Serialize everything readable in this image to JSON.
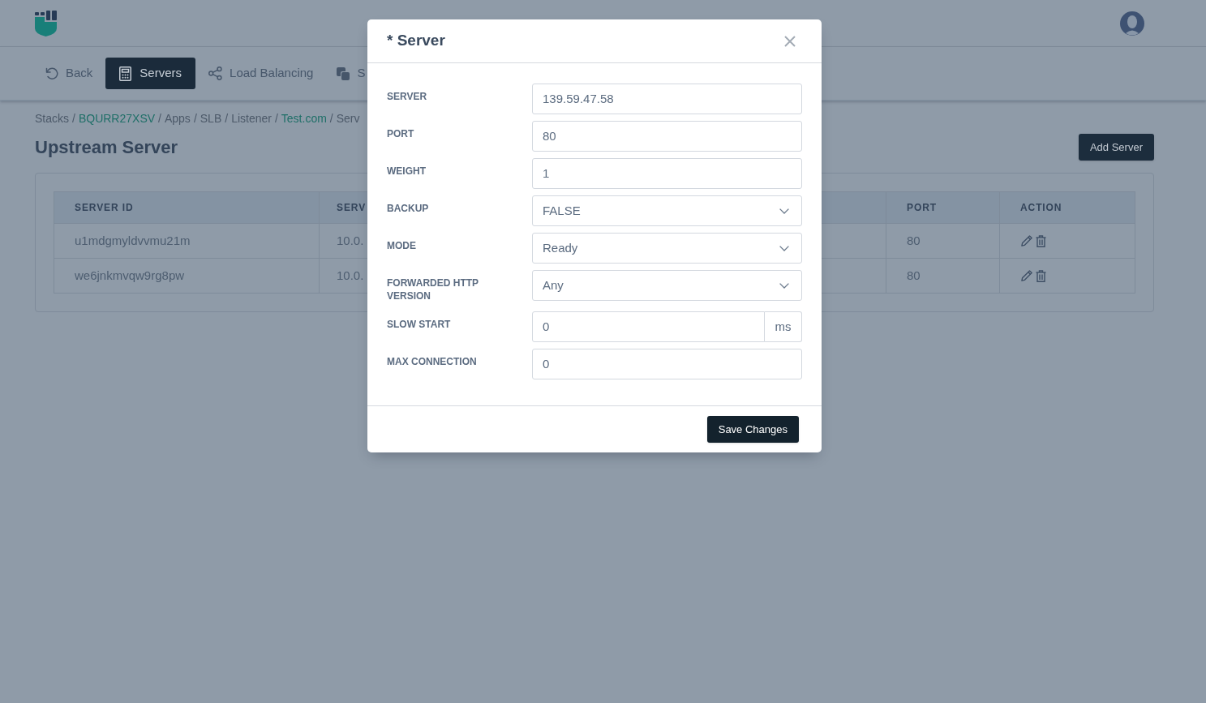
{
  "nav": [
    {
      "label": "Back",
      "selected": false
    },
    {
      "label": "Servers",
      "selected": true
    },
    {
      "label": "Load Balancing",
      "selected": false
    },
    {
      "label": "S",
      "selected": false
    }
  ],
  "breadcrumb": [
    {
      "label": "Stacks",
      "link": false
    },
    {
      "separator": "/",
      "label": "BQURR27XSV",
      "link": true
    },
    {
      "separator": "/",
      "label": "Apps",
      "link": false
    },
    {
      "separator": "/",
      "label": "SLB",
      "link": false
    },
    {
      "separator": "/",
      "label": "Listener",
      "link": false
    },
    {
      "separator": "/",
      "label": "Test.com",
      "link": true
    },
    {
      "separator": "/",
      "label": "Serv",
      "link": false
    }
  ],
  "page": {
    "title": "Upstream Server",
    "add_button": "Add Server"
  },
  "table": {
    "columns": [
      "SERVER ID",
      "SERV",
      "PORT",
      "ACTION"
    ],
    "rows": [
      {
        "cells": [
          "u1mdgmyldvvmu21m",
          "10.0.",
          "80"
        ]
      },
      {
        "cells": [
          "we6jnkmvqw9rg8pw",
          "10.0.",
          "80"
        ]
      }
    ]
  },
  "modal": {
    "title": "* Server",
    "fields": [
      {
        "label": "SERVER",
        "kind": "text",
        "value": "139.59.47.58"
      },
      {
        "label": "PORT",
        "kind": "text",
        "value": "80"
      },
      {
        "label": "WEIGHT",
        "kind": "text",
        "value": "1"
      },
      {
        "label": "BACKUP",
        "kind": "select",
        "value": "FALSE"
      },
      {
        "label": "MODE",
        "kind": "select",
        "value": "Ready"
      },
      {
        "label": "FORWARDED HTTP VERSION",
        "kind": "select",
        "value": "Any"
      },
      {
        "label": "SLOW START",
        "kind": "addon",
        "value": "0",
        "suffix": "ms"
      },
      {
        "label": "MAX CONNECTION",
        "kind": "text",
        "value": "0"
      }
    ],
    "save_button": "Save Changes"
  }
}
